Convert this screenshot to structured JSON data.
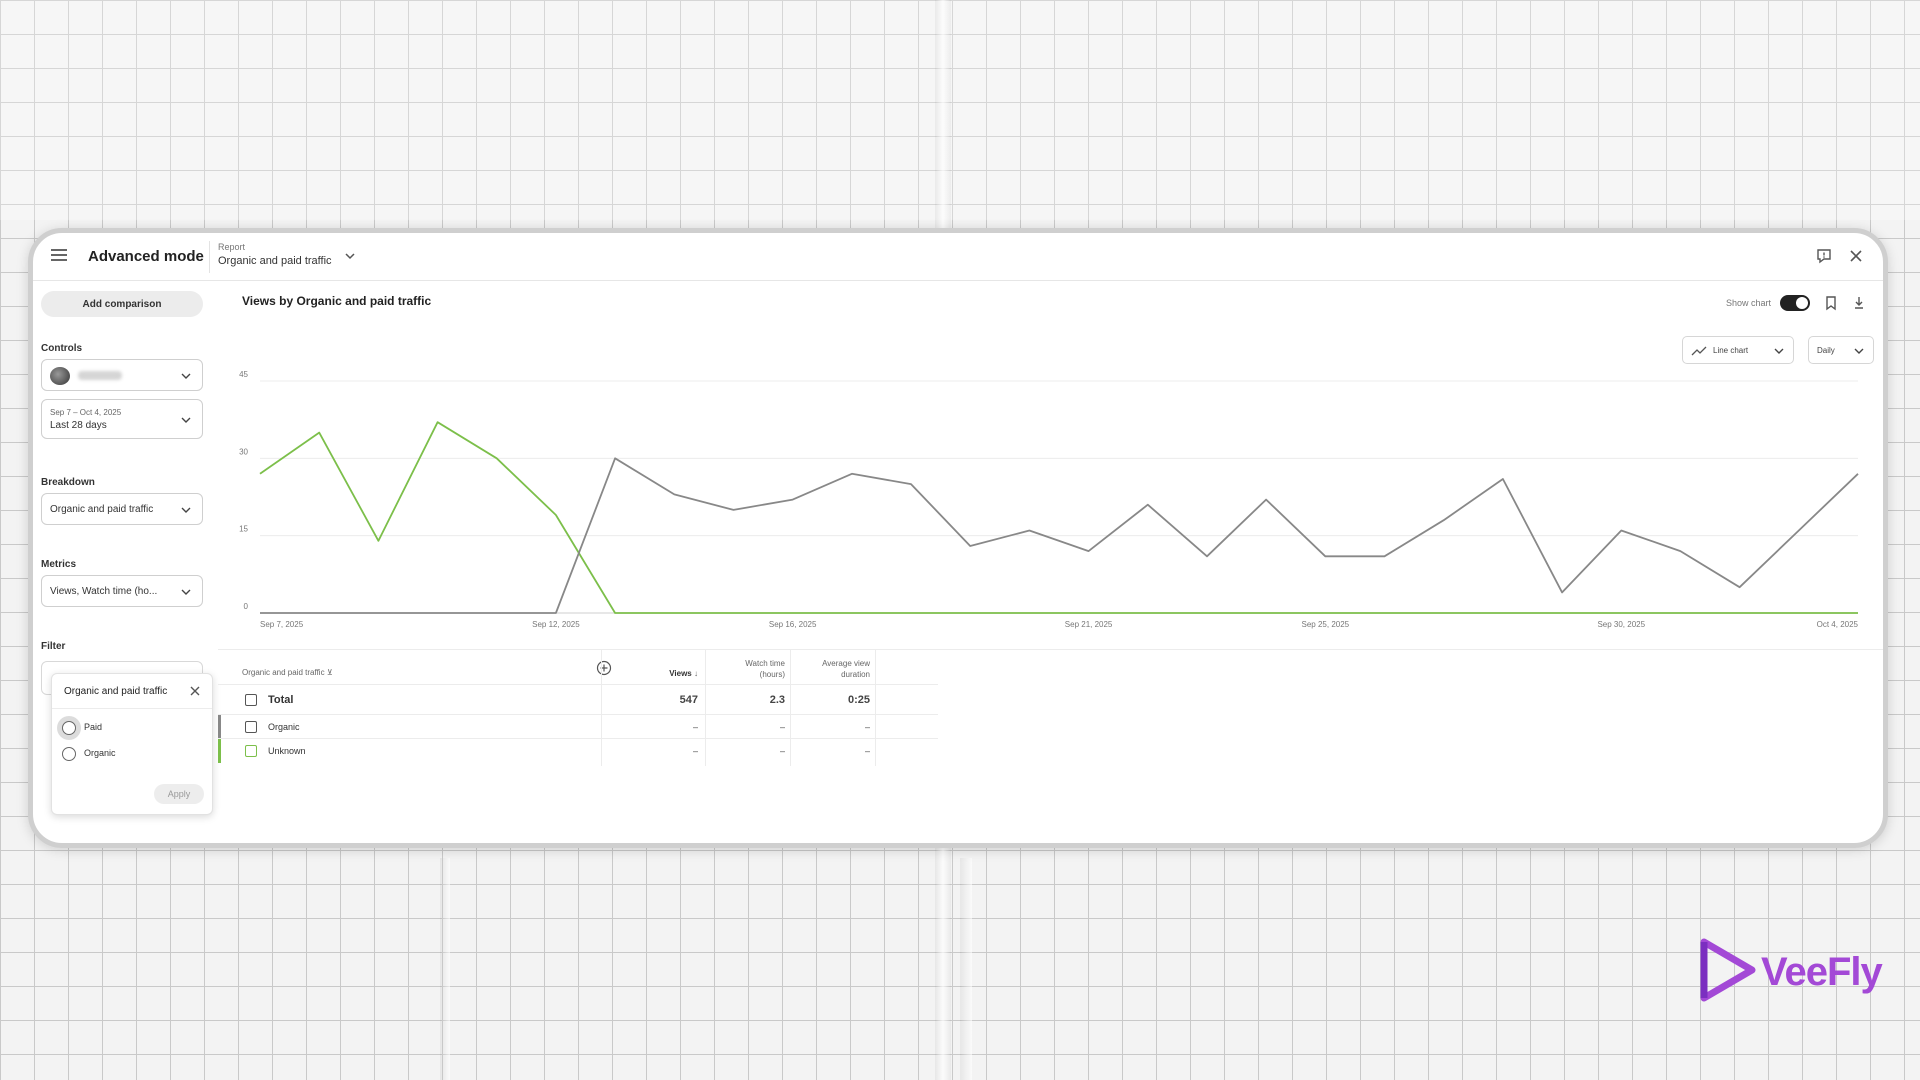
{
  "header": {
    "app_title": "Advanced mode",
    "report_caption": "Report",
    "report_name": "Organic and paid traffic"
  },
  "sidebar": {
    "add_comparison": "Add comparison",
    "controls_label": "Controls",
    "date_range_small": "Sep 7 – Oct 4, 2025",
    "date_range_big": "Last 28 days",
    "breakdown_label": "Breakdown",
    "breakdown_value": "Organic and paid traffic",
    "metrics_label": "Metrics",
    "metrics_value": "Views, Watch time (ho...",
    "filter_label": "Filter",
    "filter_popup": {
      "title": "Organic and paid traffic",
      "options": [
        "Paid",
        "Organic"
      ],
      "apply": "Apply"
    }
  },
  "chart_header": {
    "title": "Views by Organic and paid traffic",
    "show_chart": "Show chart",
    "chart_type": "Line chart",
    "period": "Daily"
  },
  "chart_data": {
    "type": "line",
    "x": [
      "Sep 7, 2025",
      "Sep 8, 2025",
      "Sep 9, 2025",
      "Sep 10, 2025",
      "Sep 11, 2025",
      "Sep 12, 2025",
      "Sep 13, 2025",
      "Sep 14, 2025",
      "Sep 15, 2025",
      "Sep 16, 2025",
      "Sep 17, 2025",
      "Sep 18, 2025",
      "Sep 19, 2025",
      "Sep 20, 2025",
      "Sep 21, 2025",
      "Sep 22, 2025",
      "Sep 23, 2025",
      "Sep 24, 2025",
      "Sep 25, 2025",
      "Sep 26, 2025",
      "Sep 27, 2025",
      "Sep 28, 2025",
      "Sep 29, 2025",
      "Sep 30, 2025",
      "Oct 1, 2025",
      "Oct 2, 2025",
      "Oct 3, 2025",
      "Oct 4, 2025"
    ],
    "x_ticks": [
      "Sep 7, 2025",
      "Sep 12, 2025",
      "Sep 16, 2025",
      "Sep 21, 2025",
      "Sep 25, 2025",
      "Sep 30, 2025",
      "Oct 4, 2025"
    ],
    "y_ticks": [
      "0",
      "15",
      "30",
      "45"
    ],
    "ylim": [
      0,
      45
    ],
    "grid": true,
    "series": [
      {
        "color": "#7cbf4a",
        "values": [
          27,
          35,
          14,
          37,
          30,
          19,
          0,
          0,
          0,
          0,
          0,
          0,
          0,
          0,
          0,
          0,
          0,
          0,
          0,
          0,
          0,
          0,
          0,
          0,
          0,
          0,
          0,
          0
        ]
      },
      {
        "color": "#888888",
        "values": [
          0,
          0,
          0,
          0,
          0,
          0,
          30,
          23,
          20,
          22,
          27,
          25,
          13,
          16,
          12,
          21,
          11,
          22,
          11,
          11,
          18,
          26,
          4,
          16,
          12,
          5,
          16,
          27
        ]
      }
    ]
  },
  "table": {
    "col_dimension": "Organic and paid traffic",
    "col_views": "Views",
    "col_watch_time_1": "Watch time",
    "col_watch_time_2": "(hours)",
    "col_avg_1": "Average view",
    "col_avg_2": "duration",
    "rows": [
      {
        "label": "Total",
        "views": "547",
        "watch": "2.3",
        "avg": "0:25"
      },
      {
        "label": "Organic",
        "views": "–",
        "watch": "–",
        "avg": "–",
        "color": "#888888"
      },
      {
        "label": "Unknown",
        "views": "–",
        "watch": "–",
        "avg": "–",
        "color": "#7cbf4a"
      }
    ]
  },
  "brand": {
    "name": "VeeFly",
    "color": "#a349d6"
  }
}
